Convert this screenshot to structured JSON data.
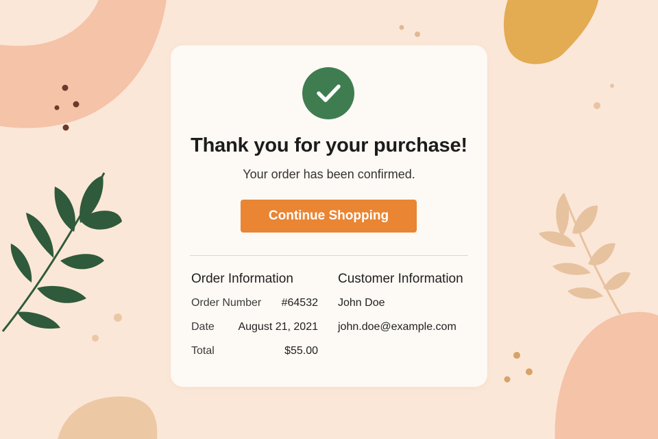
{
  "confirmation": {
    "title": "Thank you for your purchase!",
    "subtitle": "Your order has been confirmed.",
    "cta_label": "Continue Shopping",
    "icon": "checkmark-circle-icon"
  },
  "order_info": {
    "heading": "Order Information",
    "rows": [
      {
        "label": "Order Number",
        "value": "#64532"
      },
      {
        "label": "Date",
        "value": "August 21, 2021"
      },
      {
        "label": "Total",
        "value": "$55.00"
      }
    ]
  },
  "customer_info": {
    "heading": "Customer Information",
    "name": "John Doe",
    "email": "john.doe@example.com"
  },
  "colors": {
    "background": "#fbe7d8",
    "card": "#fdf9f4",
    "success_green": "#3f7d51",
    "accent_orange": "#e98533",
    "leaf_green": "#2f5a3b",
    "blob_peach": "#f4c3a8",
    "blob_mustard": "#e3ab52"
  }
}
